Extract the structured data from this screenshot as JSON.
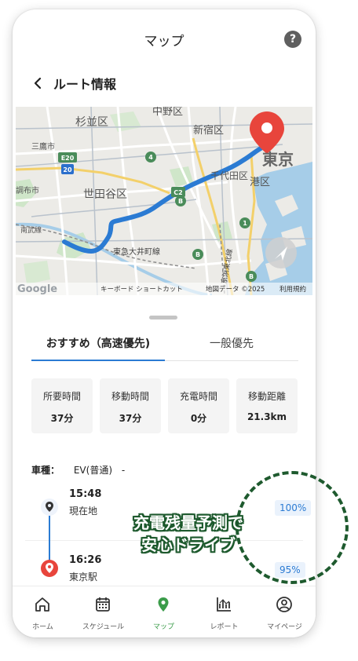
{
  "header": {
    "title": "マップ",
    "help_icon": "?"
  },
  "route": {
    "title": "ルート情報"
  },
  "map": {
    "wards": [
      "中野区",
      "杉並区",
      "新宿区",
      "千代田区",
      "世田谷区",
      "港区",
      "東京"
    ],
    "towns": [
      "三鷹市",
      "調布市",
      "南武線"
    ],
    "roads": [
      "E20",
      "20",
      "4",
      "C2",
      "1",
      "B",
      "B",
      "B",
      "東急大井町線",
      "京浜東北線"
    ],
    "attribution": {
      "logo": "Google",
      "shortcuts": "キーボード ショートカット",
      "data": "地図データ ©2025",
      "terms": "利用規約"
    },
    "colors": {
      "route": "#2b7bd3",
      "pin": "#e8453c"
    }
  },
  "tabs": [
    {
      "label": "おすすめ（高速優先)"
    },
    {
      "label": "一般優先"
    }
  ],
  "stats": [
    {
      "label": "所要時間",
      "value": "37分"
    },
    {
      "label": "移動時間",
      "value": "37分"
    },
    {
      "label": "充電時間",
      "value": "0分"
    },
    {
      "label": "移動距離",
      "value": "21.3km"
    }
  ],
  "vehicle": {
    "label": "車種：",
    "value": "EV(普通)",
    "suffix": "-"
  },
  "timeline": {
    "start": {
      "time": "15:48",
      "place": "現在地",
      "battery": "100%"
    },
    "end": {
      "time": "16:26",
      "place": "東京駅",
      "battery": "95%"
    }
  },
  "callout": {
    "line1": "充電残量予測で",
    "line2": "安心ドライブ"
  },
  "nav": [
    {
      "label": "ホーム",
      "icon": "home-icon"
    },
    {
      "label": "スケジュール",
      "icon": "calendar-icon"
    },
    {
      "label": "マップ",
      "icon": "map-pin-icon"
    },
    {
      "label": "レポート",
      "icon": "report-icon"
    },
    {
      "label": "マイページ",
      "icon": "user-icon"
    }
  ],
  "accent": "#3b9c4a"
}
